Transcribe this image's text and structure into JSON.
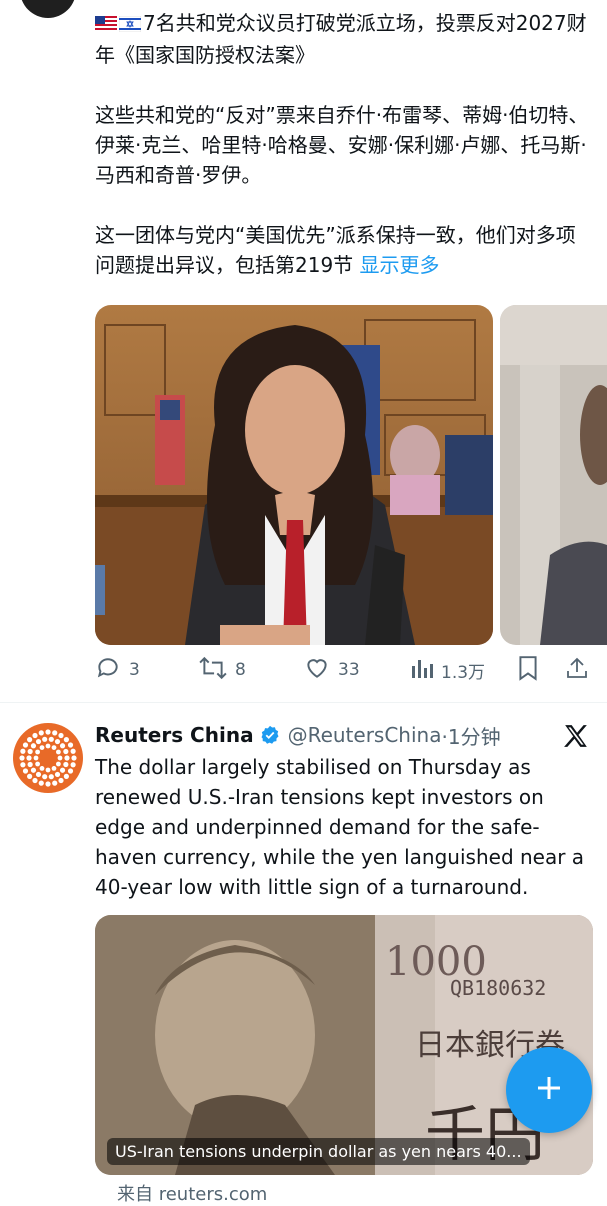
{
  "tweet1": {
    "headline": "7名共和党众议员打破党派立场，投票反对2027财年《国家国防授权法案》",
    "para2": "这些共和党的“反对”票来自乔什·布雷琴、蒂姆·伯切特、伊莱·克兰、哈里特·哈格曼、安娜·保利娜·卢娜、托马斯·马西和奇普·罗伊。",
    "para3": "这一团体与党内“美国优先”派系保持一致，他们对多项问题提出异议，包括第219节",
    "show_more": "显示更多",
    "actions": {
      "replies": "3",
      "reposts": "8",
      "likes": "33",
      "views": "1.3万"
    }
  },
  "tweet2": {
    "name": "Reuters China",
    "handle": "@ReutersChina",
    "time": "·1分钟",
    "text": "The dollar largely stabilised on Thursday as renewed U.S.-Iran tensions kept investors on edge and underpinned demand for the safe-haven currency, while the yen languished near a 40-year low with little sign of a turnaround.",
    "card_caption": "US-Iran tensions underpin dollar as yen nears 40...",
    "source": "来自 reuters.com",
    "banknote_text": "QB180632"
  },
  "colors": {
    "accent": "#1d9bf0",
    "reuters_orange": "#e86a28",
    "muted": "#536471"
  },
  "icons": [
    "us-flag-icon",
    "israel-flag-icon",
    "reply-icon",
    "repost-icon",
    "like-icon",
    "views-icon",
    "bookmark-icon",
    "share-icon",
    "verified-badge-icon",
    "x-logo-icon",
    "plus-icon"
  ]
}
